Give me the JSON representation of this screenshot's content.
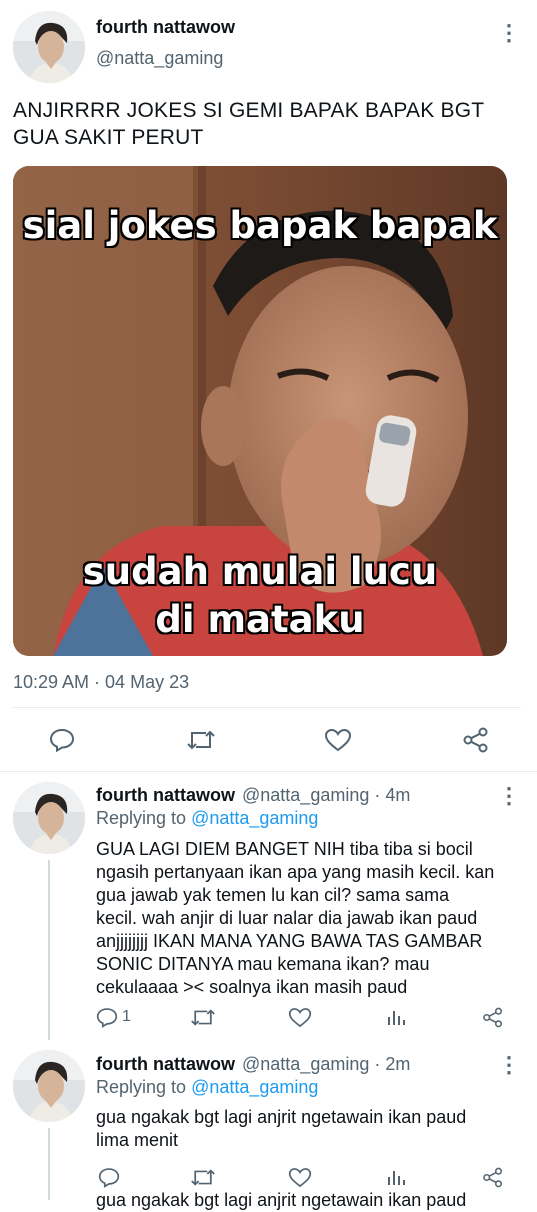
{
  "main_tweet": {
    "display_name": "fourth nattawow",
    "handle": "@natta_gaming",
    "text_line1": "ANJIRRRR JOKES SI GEMI BAPAK BAPAK BGT",
    "text_line2": "GUA SAKIT PERUT",
    "meme_top": "sial jokes bapak bapak",
    "meme_bottom_1": "sudah mulai lucu",
    "meme_bottom_2": "di mataku",
    "timestamp": "10:29 AM · 04 May 23"
  },
  "reply1": {
    "display_name": "fourth nattawow",
    "handle_time": "@natta_gaming · 4m",
    "replying_prefix": "Replying to",
    "replying_to": "@natta_gaming",
    "lines": [
      "GUA LAGI DIEM BANGET NIH tiba tiba si bocil",
      "ngasih pertanyaan ikan apa yang masih kecil. kan",
      "gua jawab yak temen lu kan cil? sama sama",
      "kecil. wah anjir di luar nalar dia jawab ikan paud",
      "anjjjjjjjj IKAN MANA YANG BAWA TAS GAMBAR",
      "SONIC DITANYA mau kemana ikan? mau",
      "cekulaaaa >< soalnya ikan masih paud"
    ],
    "reply_count": "1"
  },
  "reply2": {
    "display_name": "fourth nattawow",
    "handle_time": "@natta_gaming · 2m",
    "replying_prefix": "Replying to",
    "replying_to": "@natta_gaming",
    "lines": [
      "gua ngakak bgt lagi anjrit ngetawain ikan paud",
      "lima menit"
    ]
  },
  "cutoff_text": "gua ngakak bgt lagi anjrit ngetawain ikan paud",
  "colors": {
    "accent": "#1d9bf0",
    "secondary_text": "#536471",
    "divider": "#e6ecf0"
  },
  "icons": [
    "reply-icon",
    "retweet-icon",
    "like-icon",
    "share-icon",
    "analytics-icon",
    "more-icon"
  ]
}
